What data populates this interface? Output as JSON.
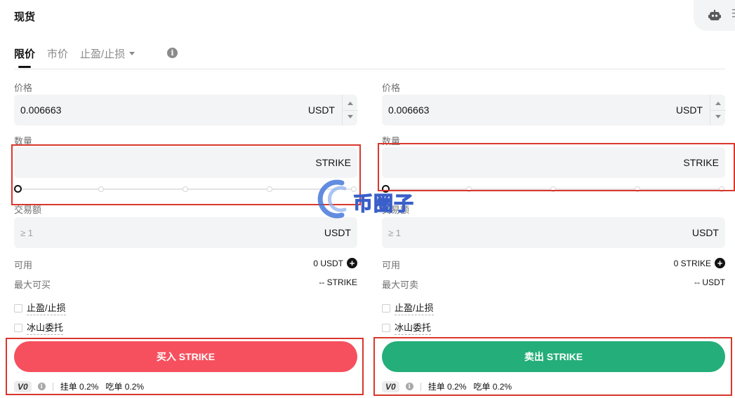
{
  "header": {
    "title": "现货",
    "robot_icon": "robot-icon",
    "menu_icon": "more-icon"
  },
  "tabs": [
    {
      "label": "限价",
      "active": true
    },
    {
      "label": "市价",
      "active": false
    },
    {
      "label": "止盈/止损",
      "active": false,
      "has_dropdown": true
    }
  ],
  "buy": {
    "price_label": "价格",
    "price_value": "0.006663",
    "price_unit": "USDT",
    "qty_label": "数量",
    "qty_unit": "STRIKE",
    "slider_percent": 0,
    "total_label": "交易额",
    "total_placeholder": "≥ 1",
    "total_unit": "USDT",
    "available_label": "可用",
    "available_value": "0 USDT",
    "max_label": "最大可买",
    "max_value": "-- STRIKE",
    "tpsl_label": "止盈/止损",
    "iceberg_label": "冰山委托",
    "button_label": "买入 STRIKE",
    "vip": "V0",
    "maker_fee": "挂单 0.2%",
    "taker_fee": "吃单 0.2%",
    "color": "#f6505e"
  },
  "sell": {
    "price_label": "价格",
    "price_value": "0.006663",
    "price_unit": "USDT",
    "qty_label": "数量",
    "qty_unit": "STRIKE",
    "slider_percent": 0,
    "total_label": "交易额",
    "total_placeholder": "≥ 1",
    "total_unit": "USDT",
    "available_label": "可用",
    "available_value": "0 STRIKE",
    "max_label": "最大可卖",
    "max_value": "-- USDT",
    "tpsl_label": "止盈/止损",
    "iceberg_label": "冰山委托",
    "button_label": "卖出 STRIKE",
    "vip": "V0",
    "maker_fee": "挂单 0.2%",
    "taker_fee": "吃单 0.2%",
    "color": "#24ae79"
  },
  "watermark": {
    "text": "币圈子"
  }
}
